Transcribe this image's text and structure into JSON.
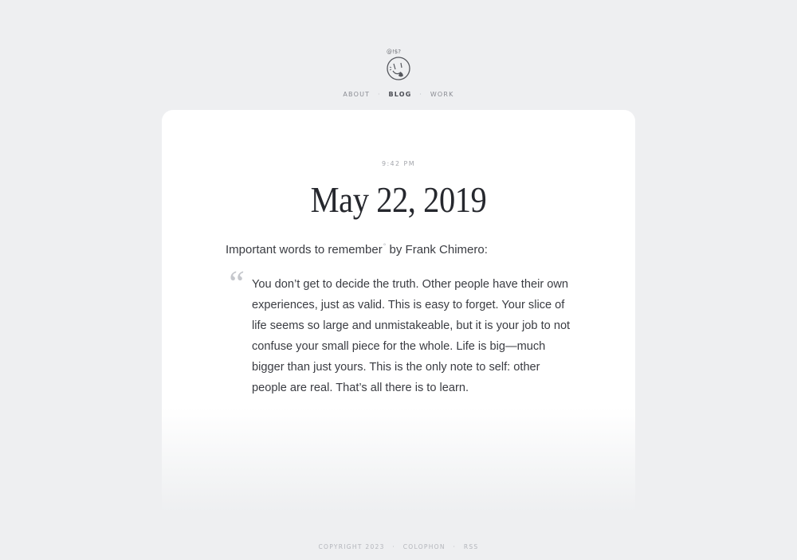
{
  "logo": {
    "icon": "smiley-face-logo-icon",
    "handwriting": "@!$?"
  },
  "nav": {
    "items": [
      {
        "label": "ABOUT",
        "active": false
      },
      {
        "label": "BLOG",
        "active": true
      },
      {
        "label": "WORK",
        "active": false
      }
    ],
    "separator": "·"
  },
  "post": {
    "time": "9:42 PM",
    "title": "May 22, 2019",
    "intro_text": "Important words to remember",
    "intro_footnote": "°",
    "intro_attribution": " by Frank Chimero:",
    "quote_mark": "“",
    "quote": "You don’t get to decide the truth. Other people have their own experiences, just as valid. This is easy to forget. Your slice of life seems so large and unmistakeable, but it is your job to not confuse your small piece for the whole. Life is big—much bigger than just yours. This is the only note to self: other people are real. That’s all there is to learn."
  },
  "footer": {
    "copyright": "COPYRIGHT 2023",
    "colophon": "COLOPHON",
    "rss": "RSS",
    "separator": "·"
  },
  "colors": {
    "background": "#eeeff1",
    "card": "#ffffff",
    "text": "#2b2d33"
  }
}
